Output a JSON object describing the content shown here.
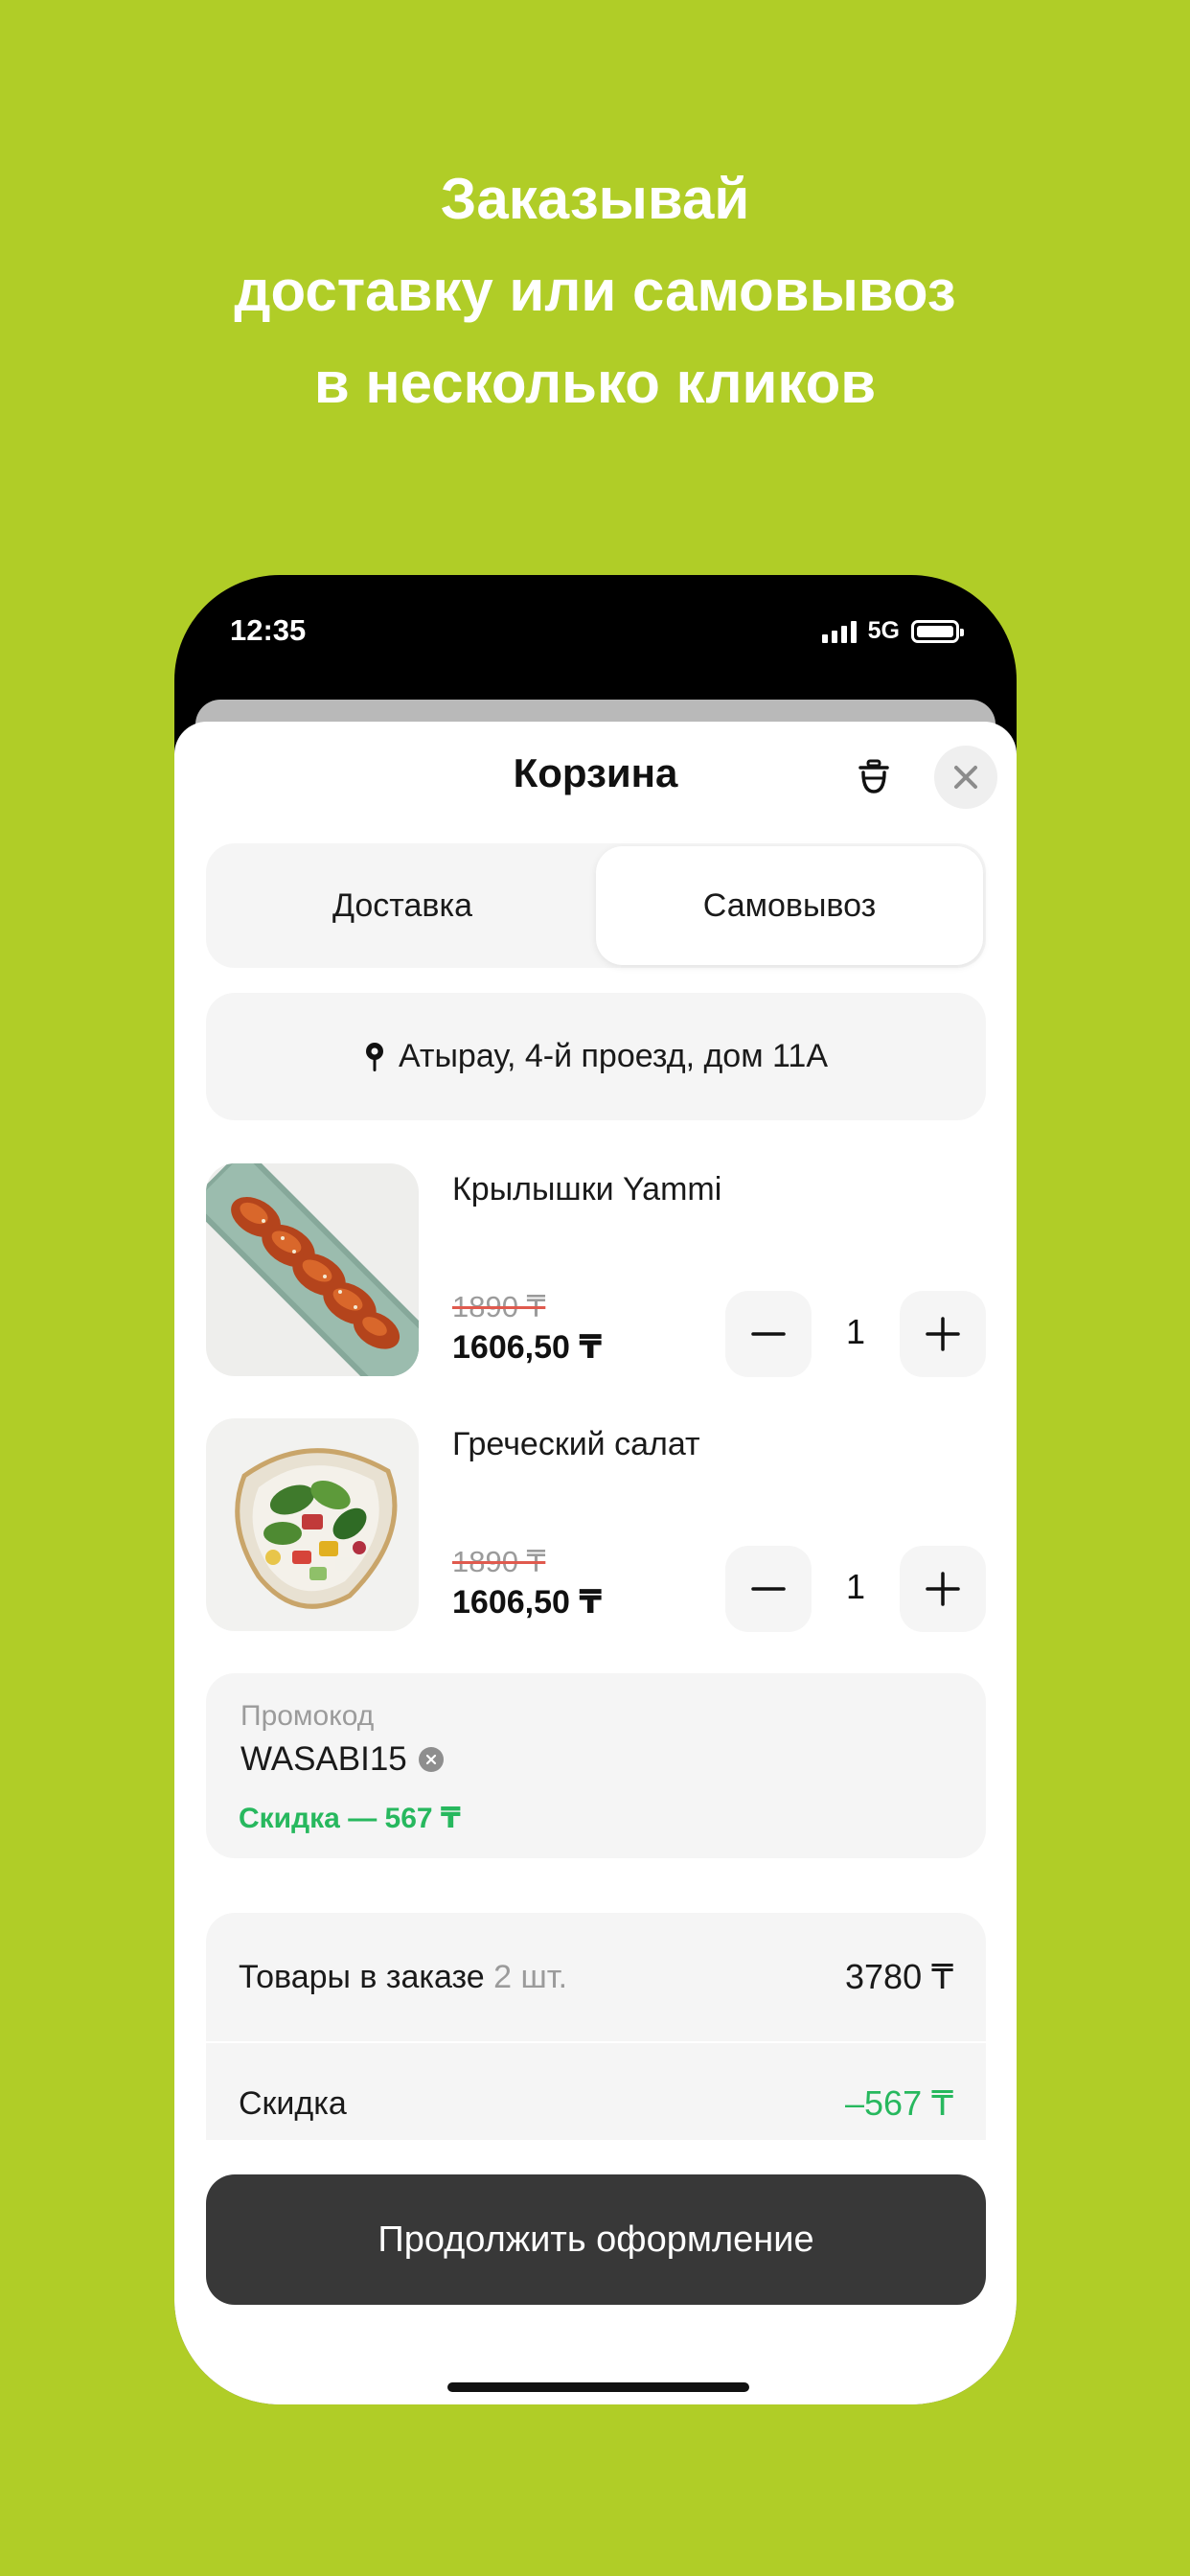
{
  "headline": {
    "line1": "Заказывай",
    "line2": "доставку или самовывоз",
    "line3": "в несколько кликов"
  },
  "status_bar": {
    "time": "12:35",
    "network": "5G"
  },
  "cart": {
    "title": "Корзина",
    "icons": {
      "trash": "trash-icon",
      "close": "close-icon"
    },
    "tabs": [
      {
        "label": "Доставка",
        "active": false
      },
      {
        "label": "Самовывоз",
        "active": true
      }
    ],
    "address": "Атырау, 4-й проезд, дом 11A",
    "items": [
      {
        "name": "Крылышки Yammi",
        "old_price": "1890 ₸",
        "new_price": "1606,50 ₸",
        "quantity": "1",
        "image": "chicken-wings-photo"
      },
      {
        "name": "Греческий салат",
        "old_price": "1890 ₸",
        "new_price": "1606,50 ₸",
        "quantity": "1",
        "image": "greek-salad-photo"
      }
    ],
    "promo": {
      "label": "Промокод",
      "code": "WASABI15",
      "discount": "Скидка — 567 ₸"
    },
    "summary": {
      "items_label": "Товары в заказе",
      "items_count": "2 шт.",
      "items_total": "3780 ₸",
      "discount_label": "Скидка",
      "discount_value": "–567 ₸"
    },
    "cta": "Продолжить оформление"
  },
  "colors": {
    "background": "#b0cd27",
    "accent_green": "#27b85e",
    "cta": "#383838",
    "strike": "#e05a4e"
  }
}
